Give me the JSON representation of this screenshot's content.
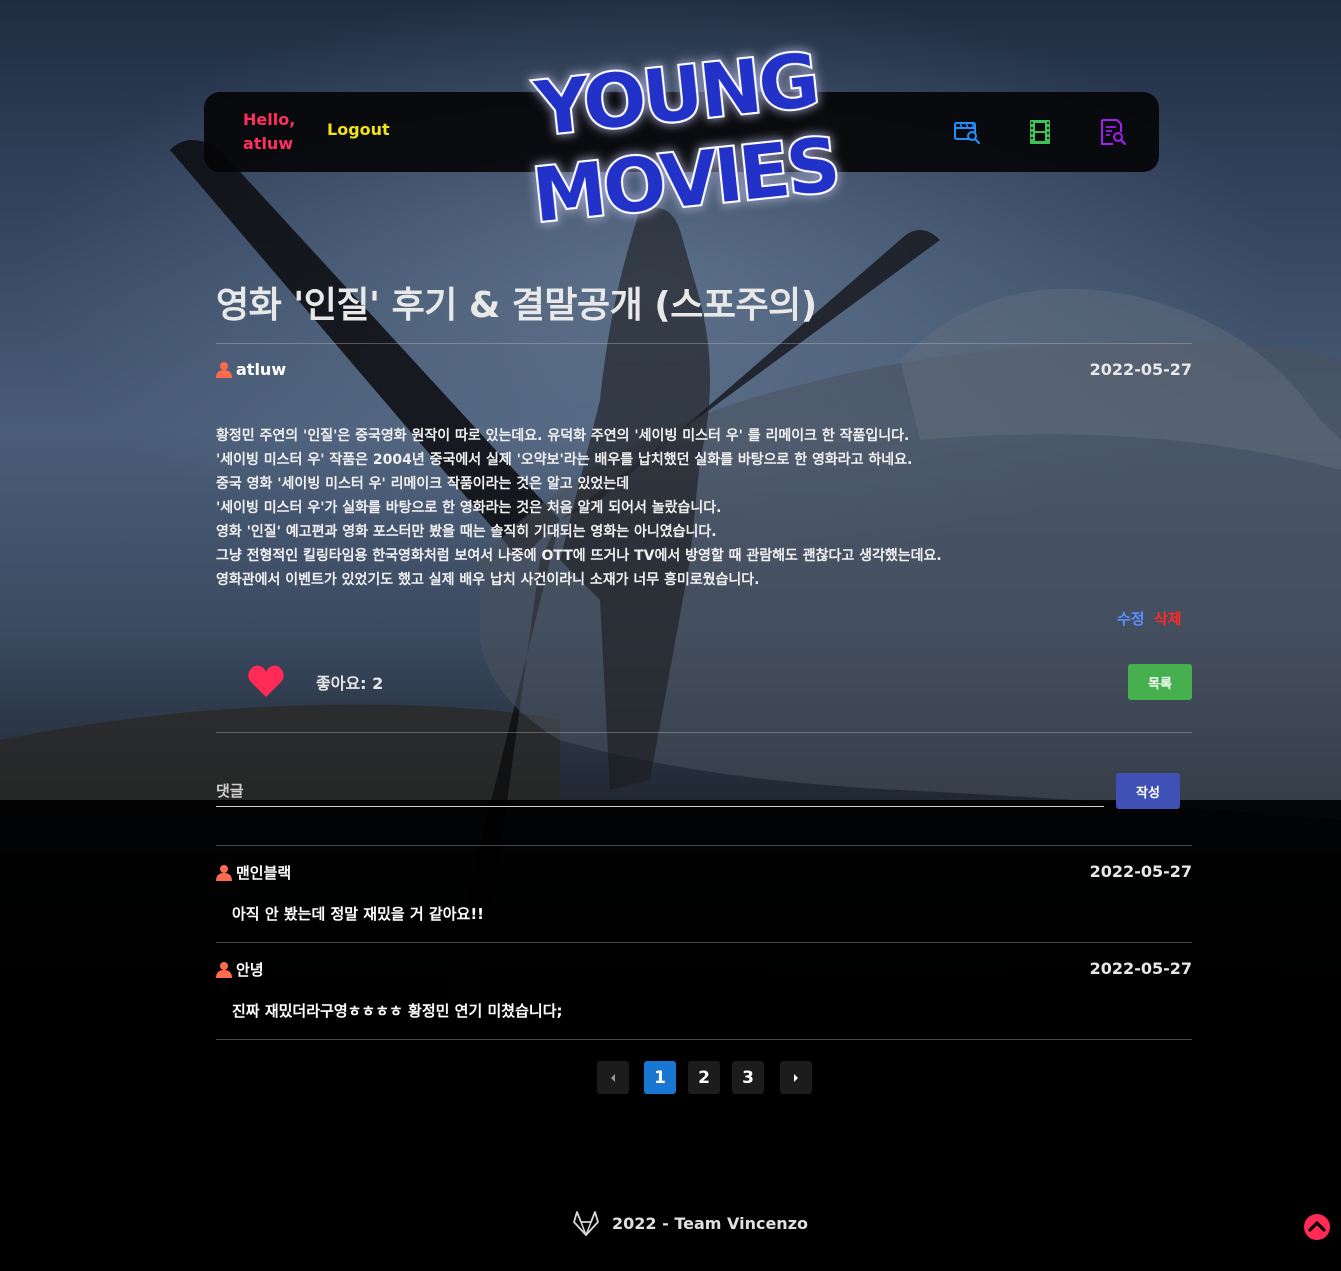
{
  "nav": {
    "hello": "Hello,",
    "username": "atluw",
    "logout": "Logout",
    "icons": [
      "movie-search-icon",
      "film-strip-icon",
      "document-search-icon"
    ]
  },
  "logo": {
    "line1": "YOUNG",
    "line2": "MOVIES"
  },
  "post": {
    "title": "영화 '인질' 후기 & 결말공개 (스포주의)",
    "author": "atluw",
    "date": "2022-05-27",
    "lines": [
      "황정민 주연의 '인질'은 중국영화 원작이 따로 있는데요. 유덕화 주연의 '세이빙 미스터 우' 를 리메이크 한 작품입니다.",
      "'세이빙 미스터 우' 작품은 2004년 중국에서 실제 '오약보'라는 배우를 납치했던 실화를 바탕으로 한 영화라고 하네요.",
      "중국 영화 '세이빙 미스터 우' 리메이크 작품이라는 것은 알고 있었는데",
      "'세이빙 미스터 우'가 실화를 바탕으로 한 영화라는 것은 처음 알게 되어서 놀랐습니다.",
      "영화 '인질' 예고편과 영화 포스터만 봤을 때는 솔직히 기대되는 영화는 아니였습니다.",
      "그냥 전형적인 킬링타임용 한국영화처럼 보여서 나중에 OTT에 뜨거나 TV에서 방영할 때 관람해도 괜찮다고 생각했는데요.",
      "영화관에서 이벤트가 있었기도 했고 실제 배우 납치 사건이라니 소재가 너무 흥미로웠습니다."
    ],
    "edit_label": "수정",
    "delete_label": "삭제",
    "likes_label": "좋아요: 2",
    "list_button": "목록"
  },
  "comment_form": {
    "placeholder": "댓글",
    "submit_label": "작성"
  },
  "comments": [
    {
      "author": "맨인블랙",
      "date": "2022-05-27",
      "text": "아직 안 봤는데 정말 재밌을 거 같아요!!"
    },
    {
      "author": "안녕",
      "date": "2022-05-27",
      "text": "진짜 재밌더라구영ㅎㅎㅎㅎ 황정민 연기 미쳤습니다;"
    }
  ],
  "pagination": {
    "pages": [
      "1",
      "2",
      "3"
    ],
    "current": "1"
  },
  "footer": {
    "text": "2022 - Team Vincenzo"
  },
  "colors": {
    "hello": "#ff2f5f",
    "logout": "#f2e21b",
    "icon_blue": "#1e90ff",
    "icon_green": "#3cc45a",
    "icon_purple": "#a020f0",
    "like_heart": "#ff2a55",
    "edit": "#5a8dff",
    "delete": "#ff2a2a",
    "list_button": "#45b04d",
    "write_button": "#3f51b5",
    "active_page": "#1976d2",
    "author_icon": "#ff6a4d"
  }
}
